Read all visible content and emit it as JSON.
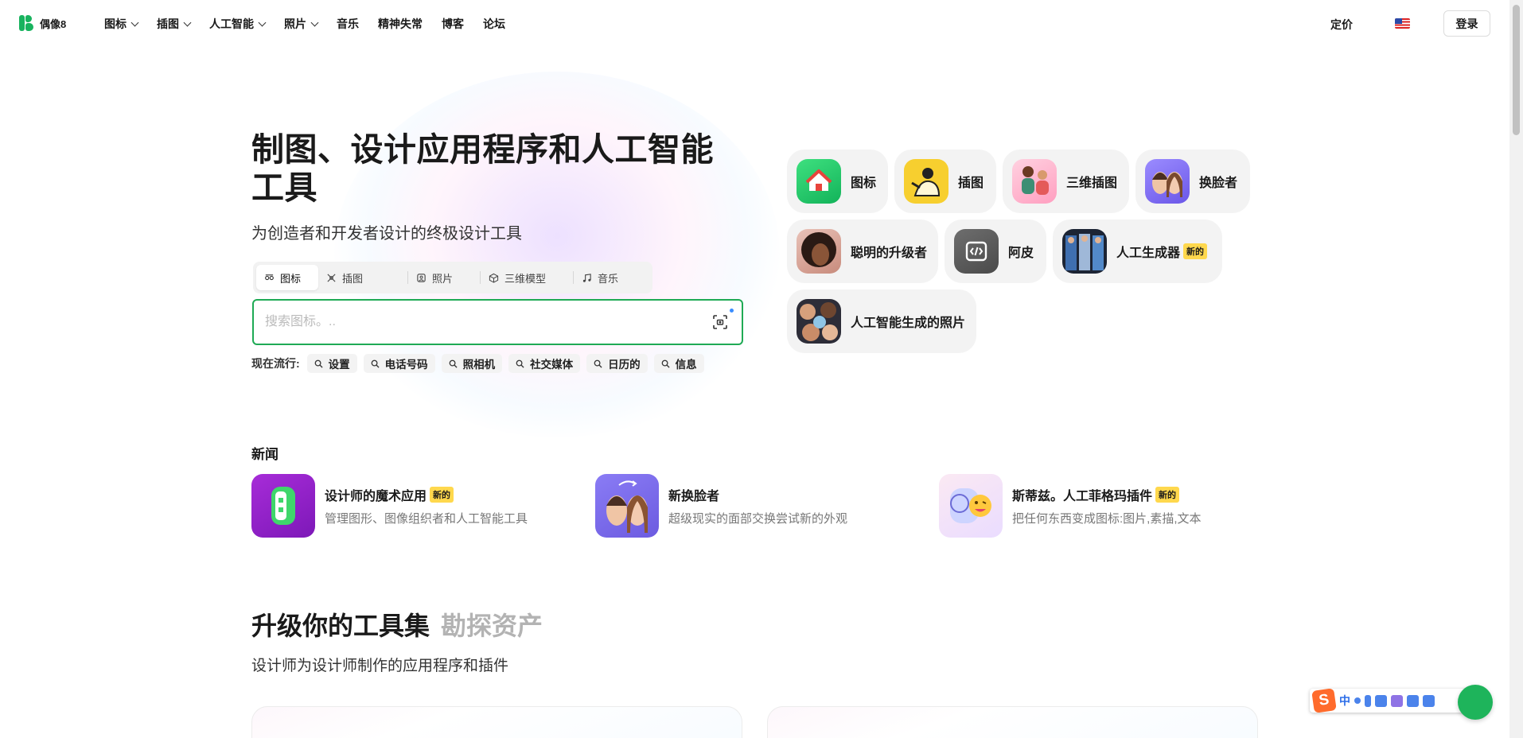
{
  "header": {
    "logo_text": "偶像8",
    "nav": [
      {
        "label": "图标",
        "dropdown": true
      },
      {
        "label": "插图",
        "dropdown": true
      },
      {
        "label": "人工智能",
        "dropdown": true
      },
      {
        "label": "照片",
        "dropdown": true
      },
      {
        "label": "音乐",
        "dropdown": false
      },
      {
        "label": "精神失常",
        "dropdown": false
      },
      {
        "label": "博客",
        "dropdown": false
      },
      {
        "label": "论坛",
        "dropdown": false
      }
    ],
    "pricing_label": "定价",
    "login_label": "登录"
  },
  "hero": {
    "title": "制图、设计应用程序和人工智能工具",
    "subtitle": "为创造者和开发者设计的终极设计工具",
    "tabs": [
      {
        "label": "图标",
        "icon": "icon-tab-icon",
        "active": true
      },
      {
        "label": "插图",
        "icon": "illustration-tab-icon",
        "active": false
      },
      {
        "label": "照片",
        "icon": "photo-tab-icon",
        "active": false
      },
      {
        "label": "三维模型",
        "icon": "3d-cube-icon",
        "active": false
      },
      {
        "label": "音乐",
        "icon": "music-note-icon",
        "active": false
      }
    ],
    "search_placeholder": "搜索图标。..",
    "trending_label": "现在流行:",
    "trending": [
      "设置",
      "电话号码",
      "照相机",
      "社交媒体",
      "日历的",
      "信息"
    ]
  },
  "apps": [
    {
      "label": "图标",
      "badge": ""
    },
    {
      "label": "插图",
      "badge": ""
    },
    {
      "label": "三维插图",
      "badge": ""
    },
    {
      "label": "换脸者",
      "badge": ""
    },
    {
      "label": "聪明的升级者",
      "badge": ""
    },
    {
      "label": "阿皮",
      "badge": ""
    },
    {
      "label": "人工生成器",
      "badge": "新的"
    },
    {
      "label": "人工智能生成的照片",
      "badge": ""
    }
  ],
  "news": {
    "heading": "新闻",
    "items": [
      {
        "title": "设计师的魔术应用",
        "badge": "新的",
        "desc": "管理图形、图像组织者和人工智能工具"
      },
      {
        "title": "新换脸者",
        "badge": "",
        "desc": "超级现实的面部交换尝试新的外观"
      },
      {
        "title": "斯蒂兹。人工菲格玛插件",
        "badge": "新的",
        "desc": "把任何东西变成图标:图片,素描,文本"
      }
    ]
  },
  "upgrade": {
    "title": "升级你的工具集",
    "title_muted": "勘探资产",
    "subtitle": "设计师为设计师制作的应用程序和插件"
  },
  "ime": {
    "mode": "中"
  },
  "colors": {
    "accent": "#1faa55",
    "badge": "#ffd84d"
  }
}
